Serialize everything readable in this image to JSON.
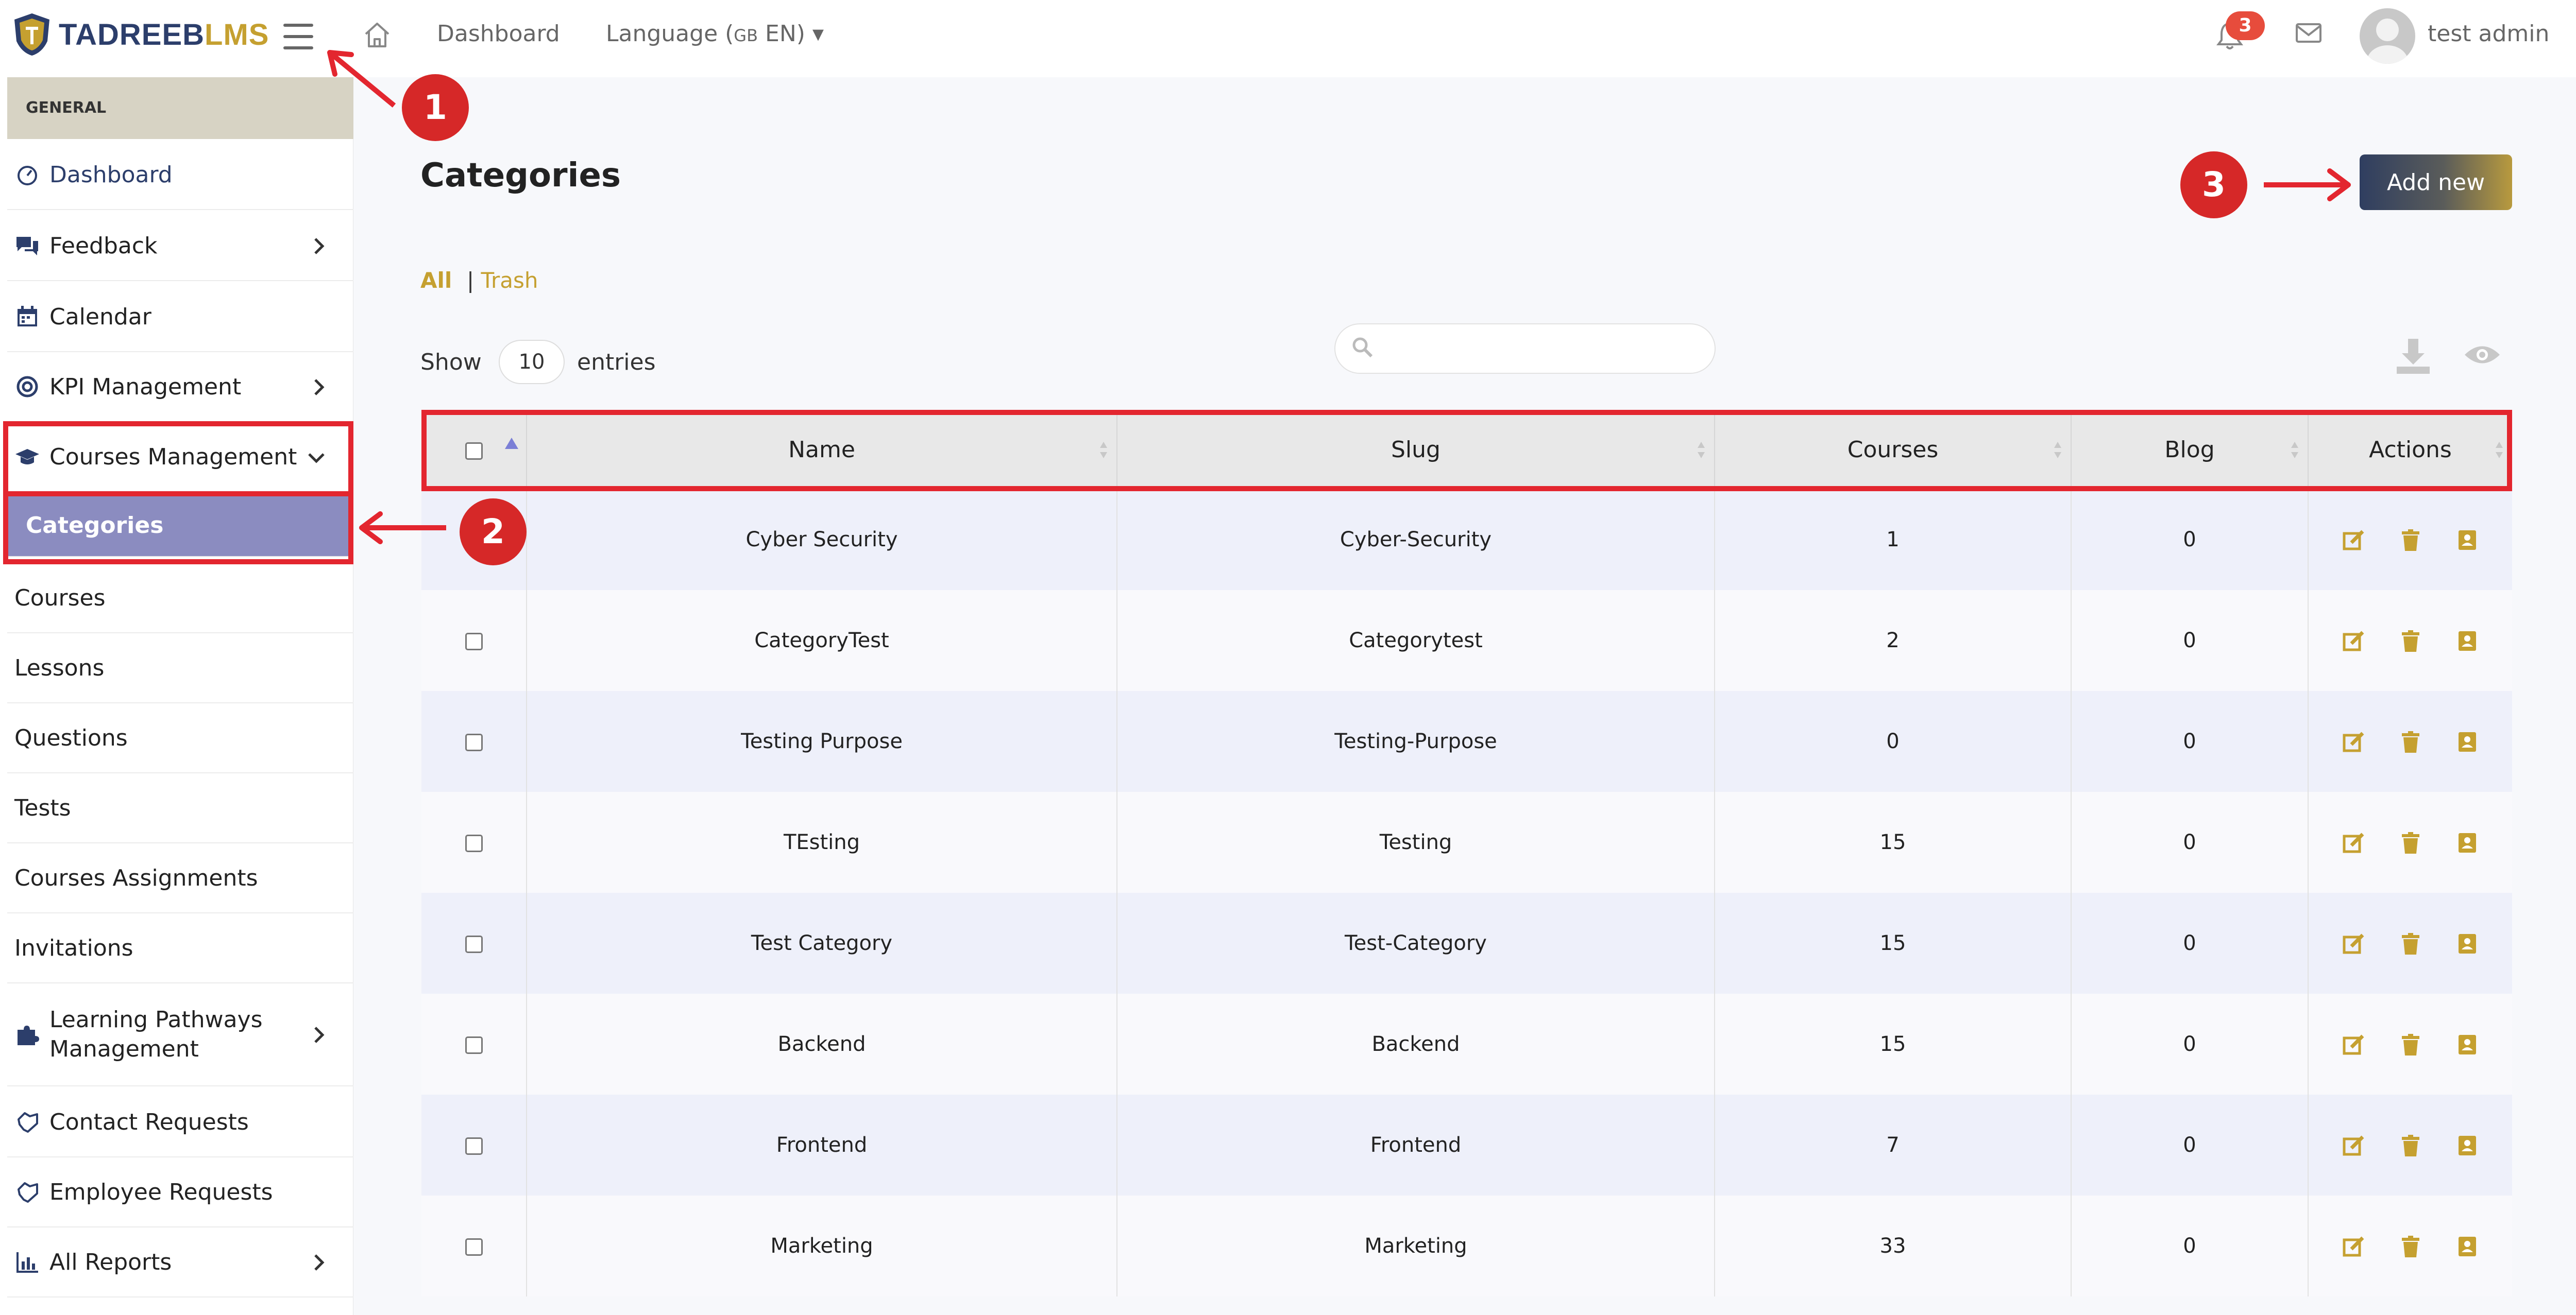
{
  "topbar": {
    "logo_part1": "TADREEB",
    "logo_part2": "LMS",
    "dashboard_link": "Dashboard",
    "language_label": "Language (",
    "language_flag": "GB",
    "language_code": " EN)",
    "notification_count": "3",
    "user_name": "test admin"
  },
  "sidebar": {
    "section": "GENERAL",
    "items": [
      {
        "label": "Dashboard",
        "icon": "gauge-icon"
      },
      {
        "label": "Feedback",
        "icon": "chat-bubbles-icon"
      },
      {
        "label": "Calendar",
        "icon": "calendar-icon"
      },
      {
        "label": "KPI Management",
        "icon": "target-icon"
      },
      {
        "label": "Courses Management",
        "icon": "graduation-cap-icon"
      },
      {
        "label": "Categories"
      },
      {
        "label": "Courses"
      },
      {
        "label": "Lessons"
      },
      {
        "label": "Questions"
      },
      {
        "label": "Tests"
      },
      {
        "label": "Courses Assignments"
      },
      {
        "label": "Invitations"
      },
      {
        "label": "Learning Pathways Management",
        "icon": "puzzle-icon"
      },
      {
        "label": "Contact Requests",
        "icon": "handshake-icon"
      },
      {
        "label": "Employee Requests",
        "icon": "handshake-icon"
      },
      {
        "label": "All Reports",
        "icon": "bar-chart-icon"
      }
    ]
  },
  "main": {
    "title": "Categories",
    "add_button": "Add new",
    "filter_all": "All",
    "filter_separator": "|",
    "filter_trash": "Trash",
    "show_label": "Show",
    "entries_value": "10",
    "entries_label": "entries",
    "search_placeholder": ""
  },
  "table": {
    "columns": [
      "Name",
      "Slug",
      "Courses",
      "Blog",
      "Actions"
    ],
    "rows": [
      {
        "name": "Cyber Security",
        "slug": "Cyber-Security",
        "courses": "1",
        "blog": "0"
      },
      {
        "name": "CategoryTest",
        "slug": "Categorytest",
        "courses": "2",
        "blog": "0"
      },
      {
        "name": "Testing Purpose",
        "slug": "Testing-Purpose",
        "courses": "0",
        "blog": "0"
      },
      {
        "name": "TEsting",
        "slug": "Testing",
        "courses": "15",
        "blog": "0"
      },
      {
        "name": "Test Category",
        "slug": "Test-Category",
        "courses": "15",
        "blog": "0"
      },
      {
        "name": "Backend",
        "slug": "Backend",
        "courses": "15",
        "blog": "0"
      },
      {
        "name": "Frontend",
        "slug": "Frontend",
        "courses": "7",
        "blog": "0"
      },
      {
        "name": "Marketing",
        "slug": "Marketing",
        "courses": "33",
        "blog": "0"
      }
    ]
  },
  "annotations": {
    "step1": "1",
    "step2": "2",
    "step3": "3"
  },
  "colors": {
    "accent_gold": "#c5a030",
    "brand_navy": "#2c3e6b",
    "annotation_red": "#e3262f",
    "selected_item": "#8b8cc0"
  }
}
